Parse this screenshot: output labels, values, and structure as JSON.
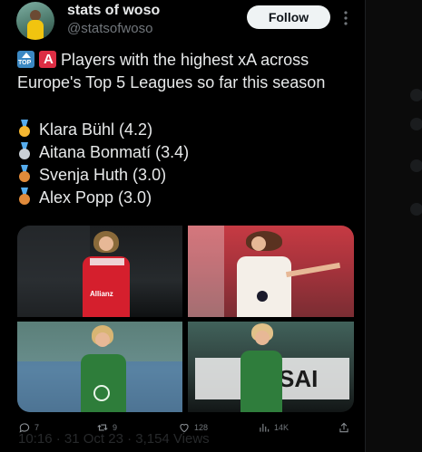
{
  "user": {
    "name": "stats of woso",
    "handle": "@statsofwoso",
    "follow_label": "Follow"
  },
  "tweet": {
    "headline_line1": "Players with the highest xA across",
    "headline_line2": "Europe's Top 5 Leagues so far this season",
    "players": [
      {
        "text": "Klara Bühl (4.2)",
        "medal": "gold-medal-icon",
        "medal_color": "#f5b731"
      },
      {
        "text": "Aitana Bonmatí (3.4)",
        "medal": "silver-medal-icon",
        "medal_color": "#c9cfd6"
      },
      {
        "text": "Svenja Huth (3.0)",
        "medal": "bronze-medal-icon",
        "medal_color": "#e08a3a"
      },
      {
        "text": "Alex Popp (3.0)",
        "medal": "bronze-medal-icon",
        "medal_color": "#e08a3a"
      }
    ],
    "ghost_footer": "10:16 · 31 Oct 23 · 3,154 Views"
  },
  "media": {
    "photo_1_text": "Allianz",
    "photo_4_text": "SAI"
  },
  "actions": {
    "replies": "7",
    "retweets": "9",
    "likes": "128",
    "views": "14K"
  },
  "colors": {
    "background": "#000000",
    "text": "#e7e9ea",
    "muted": "#71767b",
    "follow_bg": "#eff3f4"
  }
}
